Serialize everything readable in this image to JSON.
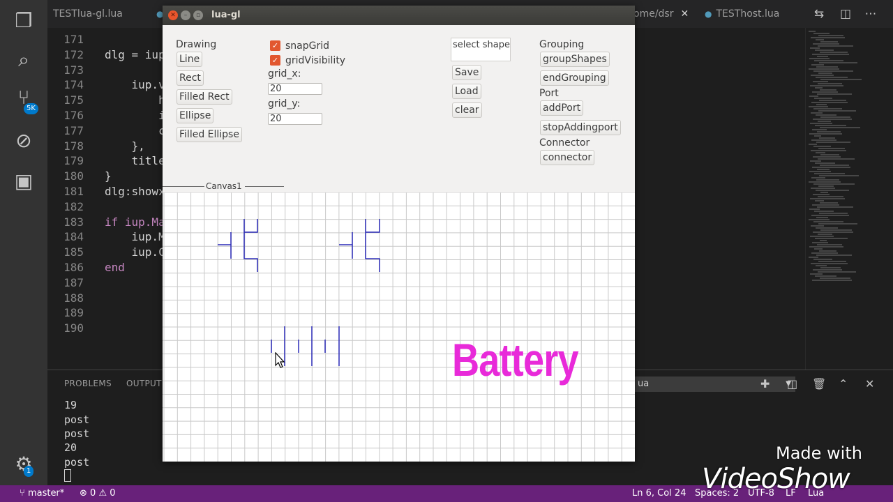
{
  "vscode": {
    "tabs": [
      {
        "label": "TESTlua-gl.lua"
      },
      {
        "label": "ome/dsr"
      },
      {
        "label": "TESThost.lua"
      }
    ],
    "source_control_badge": "5K",
    "settings_badge": "1",
    "code_lines": [
      {
        "num": "171",
        "text": ""
      },
      {
        "num": "172",
        "text": "dlg = iup"
      },
      {
        "num": "173",
        "text": ""
      },
      {
        "num": "174",
        "text": "    iup.v"
      },
      {
        "num": "175",
        "text": "        h"
      },
      {
        "num": "176",
        "text": "        i"
      },
      {
        "num": "177",
        "text": "        c"
      },
      {
        "num": "178",
        "text": "    },"
      },
      {
        "num": "179",
        "text": "    title"
      },
      {
        "num": "180",
        "text": "}"
      },
      {
        "num": "181",
        "text": "dlg:showx"
      },
      {
        "num": "182",
        "text": ""
      },
      {
        "num": "183",
        "text": "if iup.Ma"
      },
      {
        "num": "184",
        "text": "    iup.M"
      },
      {
        "num": "185",
        "text": "    iup.C"
      },
      {
        "num": "186",
        "text": "end"
      },
      {
        "num": "187",
        "text": ""
      },
      {
        "num": "188",
        "text": ""
      },
      {
        "num": "189",
        "text": ""
      },
      {
        "num": "190",
        "text": ""
      }
    ],
    "panel": {
      "problems_tab": "PROBLEMS",
      "output_tab": "OUTPUT",
      "output_select": "ua",
      "output_lines": [
        "19",
        "post",
        "post",
        "20",
        "post"
      ]
    },
    "status": {
      "branch": "master*",
      "errors": "0",
      "warnings": "0",
      "position": "Ln 6, Col 24",
      "spaces": "Spaces: 2",
      "encoding": "UTF-8",
      "eol": "LF",
      "language": "Lua"
    }
  },
  "dialog": {
    "title": "lua-gl",
    "drawing": {
      "heading": "Drawing",
      "line": "Line",
      "rect": "Rect",
      "filled_rect": "Filled Rect",
      "ellipse": "Ellipse",
      "filled_ellipse": "Filled Ellipse"
    },
    "options": {
      "snap_grid": "snapGrid",
      "grid_visibility": "gridVisibility",
      "grid_x_label": "grid_x:",
      "grid_x_value": "20",
      "grid_y_label": "grid_y:",
      "grid_y_value": "20"
    },
    "file": {
      "select_shape": "select shape",
      "save": "Save",
      "load": "Load",
      "clear": "clear"
    },
    "grouping": {
      "heading": "Grouping",
      "group_shapes": "groupShapes",
      "end_grouping": "endGrouping"
    },
    "port": {
      "heading": "Port",
      "add_port": "addPort",
      "stop_adding_port": "stopAddingport"
    },
    "connector": {
      "heading": "Connector",
      "connector_button": "connector"
    },
    "canvas_label": "Canvas1"
  },
  "overlay": {
    "caption": "Battery",
    "caption_color": "#e82ad9",
    "watermark_line1": "Made with",
    "watermark_line2": "VideoShow"
  }
}
